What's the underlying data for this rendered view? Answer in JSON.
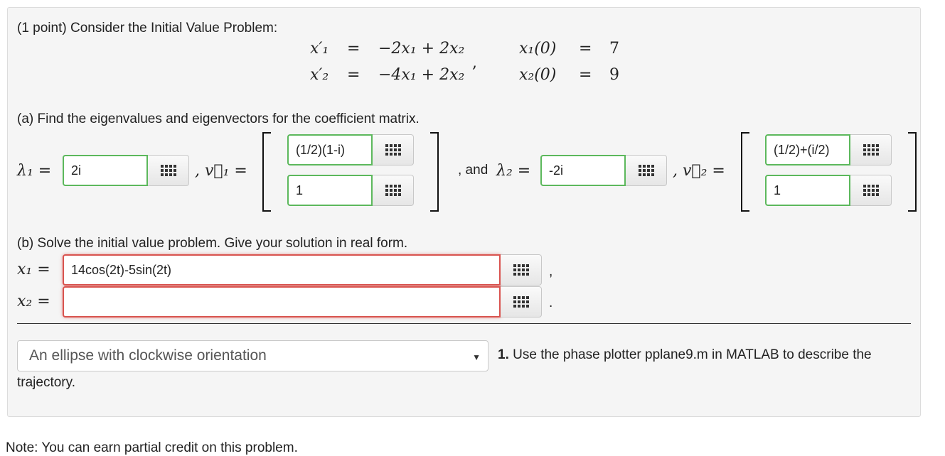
{
  "intro": "(1 point) Consider the Initial Value Problem:",
  "system": {
    "eq1_lhs": "x′₁",
    "eq1_rhs": "−2x₁ + 2x₂",
    "eq2_lhs": "x′₂",
    "eq2_rhs": "−4x₁ + 2x₂",
    "equals": "=",
    "comma": ",",
    "ic1_lhs": "x₁(0)",
    "ic1_rhs": "7",
    "ic2_lhs": "x₂(0)",
    "ic2_rhs": "9"
  },
  "part_a": {
    "prompt": "(a) Find the eigenvalues and eigenvectors for the coefficient matrix.",
    "lambda1_label": "λ₁ =",
    "lambda1_value": "2i",
    "v1_label": ", v⃗₁ =",
    "v1_top": "(1/2)(1-i)",
    "v1_bottom": "1",
    "and_label": ", and",
    "lambda2_label": "λ₂ =",
    "lambda2_value": "-2i",
    "v2_label": ", v⃗₂ =",
    "v2_top": "(1/2)+(i/2)",
    "v2_bottom": "1"
  },
  "part_b": {
    "prompt": "(b) Solve the initial value problem. Give your solution in real form.",
    "x1_label": "x₁ =",
    "x1_value": "14cos(2t)-5sin(2t)",
    "x1_suffix": ",",
    "x2_label": "x₂ =",
    "x2_value": "",
    "x2_suffix": "."
  },
  "trajectory": {
    "selected": "An ellipse with clockwise orientation",
    "number": "1.",
    "text": "Use the phase plotter pplane9.m in MATLAB to describe the",
    "text_cont": "trajectory."
  },
  "footer_note": "Note: You can earn partial credit on this problem."
}
